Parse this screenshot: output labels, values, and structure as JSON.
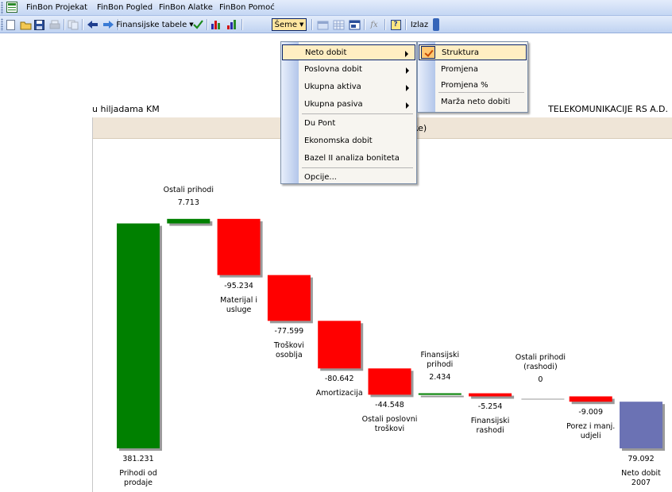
{
  "menubar": {
    "items": [
      {
        "label": "FinBon Projekat"
      },
      {
        "label": "FinBon Pogled"
      },
      {
        "label": "FinBon Alatke"
      },
      {
        "label": "FinBon Pomoć"
      }
    ]
  },
  "toolbar": {
    "finansijske_label": "Finansijske tabele",
    "seme_label": "Šeme",
    "fx_label": "fx",
    "help_label": "?",
    "izlaz_label": "Izlaz"
  },
  "page": {
    "unit_label": "u hiljadama KM",
    "company": "TELEKOMUNIKACIJE RS A.D.",
    "title_fragment": "Re)"
  },
  "menu": {
    "items": [
      {
        "label": "Neto dobit",
        "submenu": true
      },
      {
        "label": "Poslovna dobit",
        "submenu": true
      },
      {
        "label": "Ukupna aktiva",
        "submenu": true
      },
      {
        "label": "Ukupna pasiva",
        "submenu": true
      },
      {
        "label": "Du Pont",
        "submenu": false
      },
      {
        "label": "Ekonomska dobit",
        "submenu": false
      },
      {
        "label": "Bazel II analiza boniteta",
        "submenu": false
      },
      {
        "label": "Opcije...",
        "submenu": false
      }
    ],
    "submenu": [
      {
        "label": "Struktura",
        "checked": true
      },
      {
        "label": "Promjena",
        "checked": false
      },
      {
        "label": "Promjena %",
        "checked": false
      },
      {
        "label": "Marža neto dobiti",
        "checked": false
      }
    ]
  },
  "colors": {
    "positive": "#008000",
    "negative": "#ff0000",
    "total": "#6b72b4"
  },
  "chart_data": {
    "type": "waterfall",
    "bars": [
      {
        "name": "Prihodi od prodaje",
        "value": 381.231,
        "value_label": "381.231",
        "label_lines": [
          "Prihodi od",
          "prodaje"
        ],
        "kind": "total"
      },
      {
        "name": "Ostali prihodi",
        "value": 7.713,
        "value_label": "7.713",
        "label_lines": [
          "Ostali prihodi"
        ],
        "kind": "positive"
      },
      {
        "name": "Materijal i usluge",
        "value": -95.234,
        "value_label": "-95.234",
        "label_lines": [
          "Materijal i",
          "usluge"
        ],
        "kind": "negative"
      },
      {
        "name": "Troškovi osoblja",
        "value": -77.599,
        "value_label": "-77.599",
        "label_lines": [
          "Troškovi",
          "osoblja"
        ],
        "kind": "negative"
      },
      {
        "name": "Amortizacija",
        "value": -80.642,
        "value_label": "-80.642",
        "label_lines": [
          "Amortizacija"
        ],
        "kind": "negative"
      },
      {
        "name": "Ostali poslovni troškovi",
        "value": -44.548,
        "value_label": "-44.548",
        "label_lines": [
          "Ostali poslovni",
          "troškovi"
        ],
        "kind": "negative"
      },
      {
        "name": "Finansijski prihodi",
        "value": 2.434,
        "value_label": "2.434",
        "label_lines": [
          "Finansijski",
          "prihodi"
        ],
        "kind": "positive"
      },
      {
        "name": "Finansijski rashodi",
        "value": -5.254,
        "value_label": "-5.254",
        "label_lines": [
          "Finansijski",
          "rashodi"
        ],
        "kind": "negative"
      },
      {
        "name": "Ostali prihodi (rashodi)",
        "value": 0,
        "value_label": "0",
        "label_lines": [
          "Ostali prihodi",
          "(rashodi)"
        ],
        "kind": "positive"
      },
      {
        "name": "Porez i manj. udjeli",
        "value": -9.009,
        "value_label": "-9.009",
        "label_lines": [
          "Porez i manj.",
          "udjeli"
        ],
        "kind": "negative"
      },
      {
        "name": "Neto dobit 2007",
        "value": 79.092,
        "value_label": "79.092",
        "label_lines": [
          "Neto dobit",
          "2007"
        ],
        "kind": "total"
      }
    ]
  }
}
